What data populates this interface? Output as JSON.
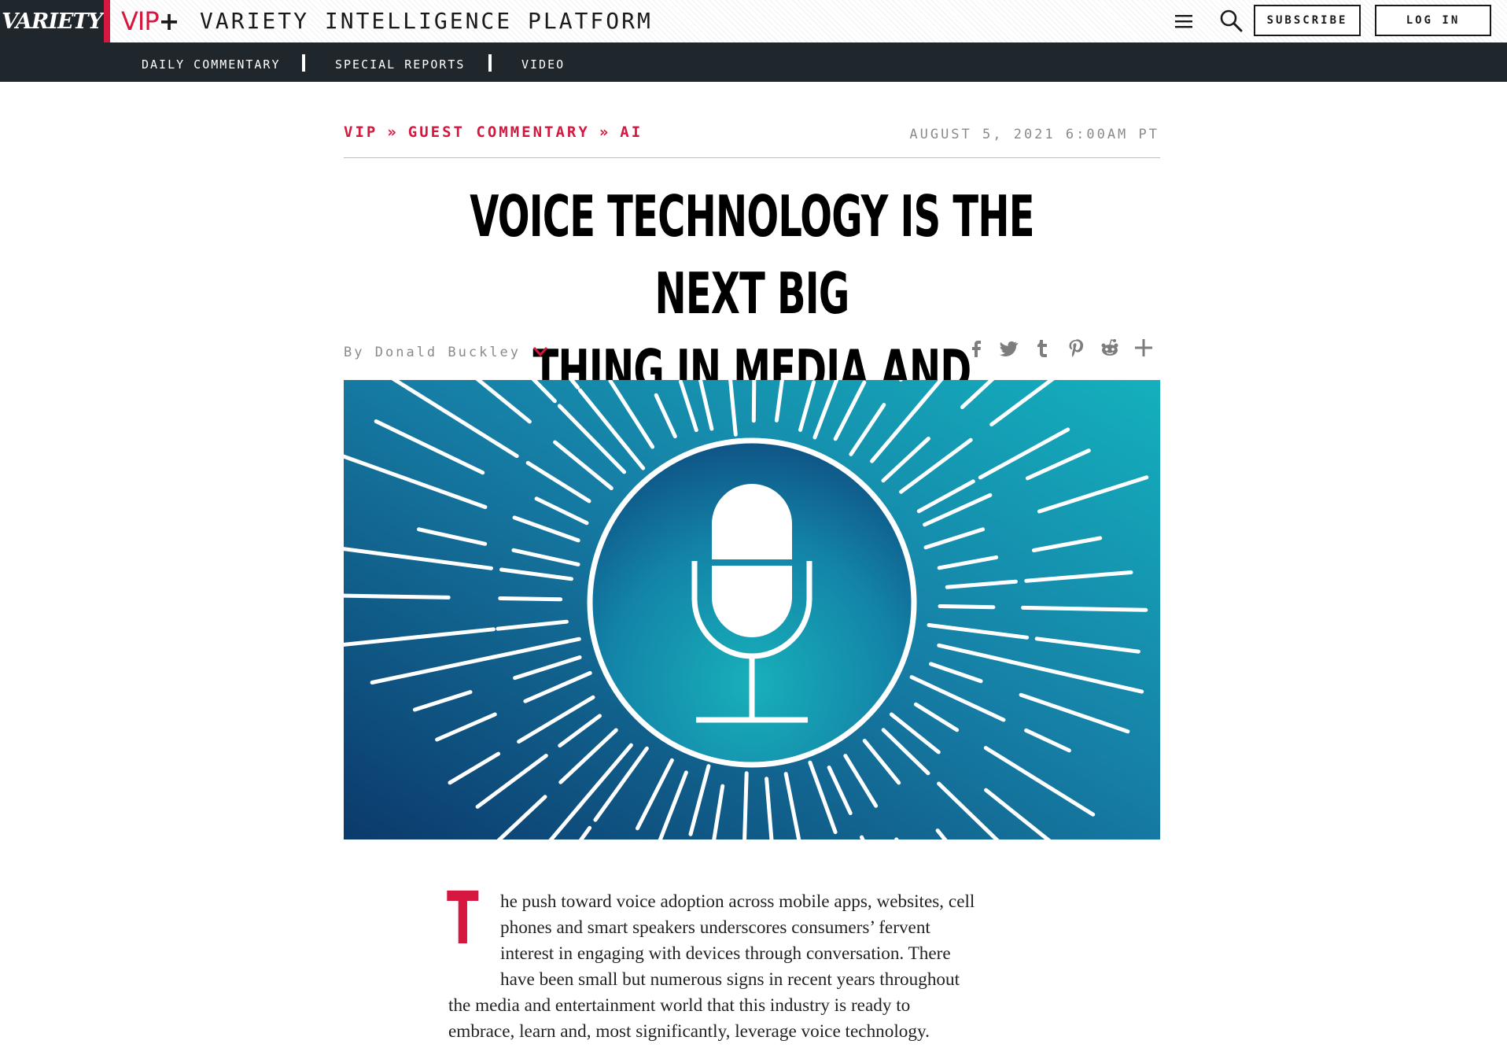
{
  "header": {
    "logo_text": "VARIETY",
    "vip_label": "VIP",
    "vip_plus": "+",
    "platform_title": "VARIETY INTELLIGENCE PLATFORM",
    "menu_icon": "hamburger-menu-icon",
    "search_icon": "search-icon",
    "subscribe_label": "SUBSCRIBE",
    "login_label": "LOG IN"
  },
  "nav": {
    "items": [
      {
        "label": "DAILY COMMENTARY"
      },
      {
        "label": "SPECIAL REPORTS"
      },
      {
        "label": "VIDEO"
      }
    ]
  },
  "article": {
    "breadcrumbs": [
      "VIP",
      "GUEST COMMENTARY",
      "AI"
    ],
    "breadcrumb_separator": "»",
    "date": "AUGUST 5, 2021 6:00AM PT",
    "headline_lines": [
      "VOICE TECHNOLOGY IS THE NEXT BIG",
      "THING IN MEDIA AND ENTERTAINMENT"
    ],
    "byline_prefix": "By",
    "author": "Donald Buckley",
    "share_icons": [
      "facebook-icon",
      "twitter-icon",
      "tumblr-icon",
      "pinterest-icon",
      "reddit-icon",
      "plus-icon"
    ],
    "hero_image": "microphone-illustration",
    "dropcap": "T",
    "body_lines": [
      "he push toward voice adoption across mobile apps, websites, cell",
      "phones and smart speakers underscores consumers’ fervent",
      "interest in engaging with devices through conversation. There",
      "have been small but numerous signs in recent years throughout",
      "the media and entertainment world that this industry is ready to",
      "embrace, learn and, most significantly, leverage voice technology."
    ]
  },
  "colors": {
    "brand_red": "#d6173f",
    "nav_dark": "#1f272c",
    "hero_teal": "#1aa8b8",
    "hero_navy": "#0d3f72"
  }
}
